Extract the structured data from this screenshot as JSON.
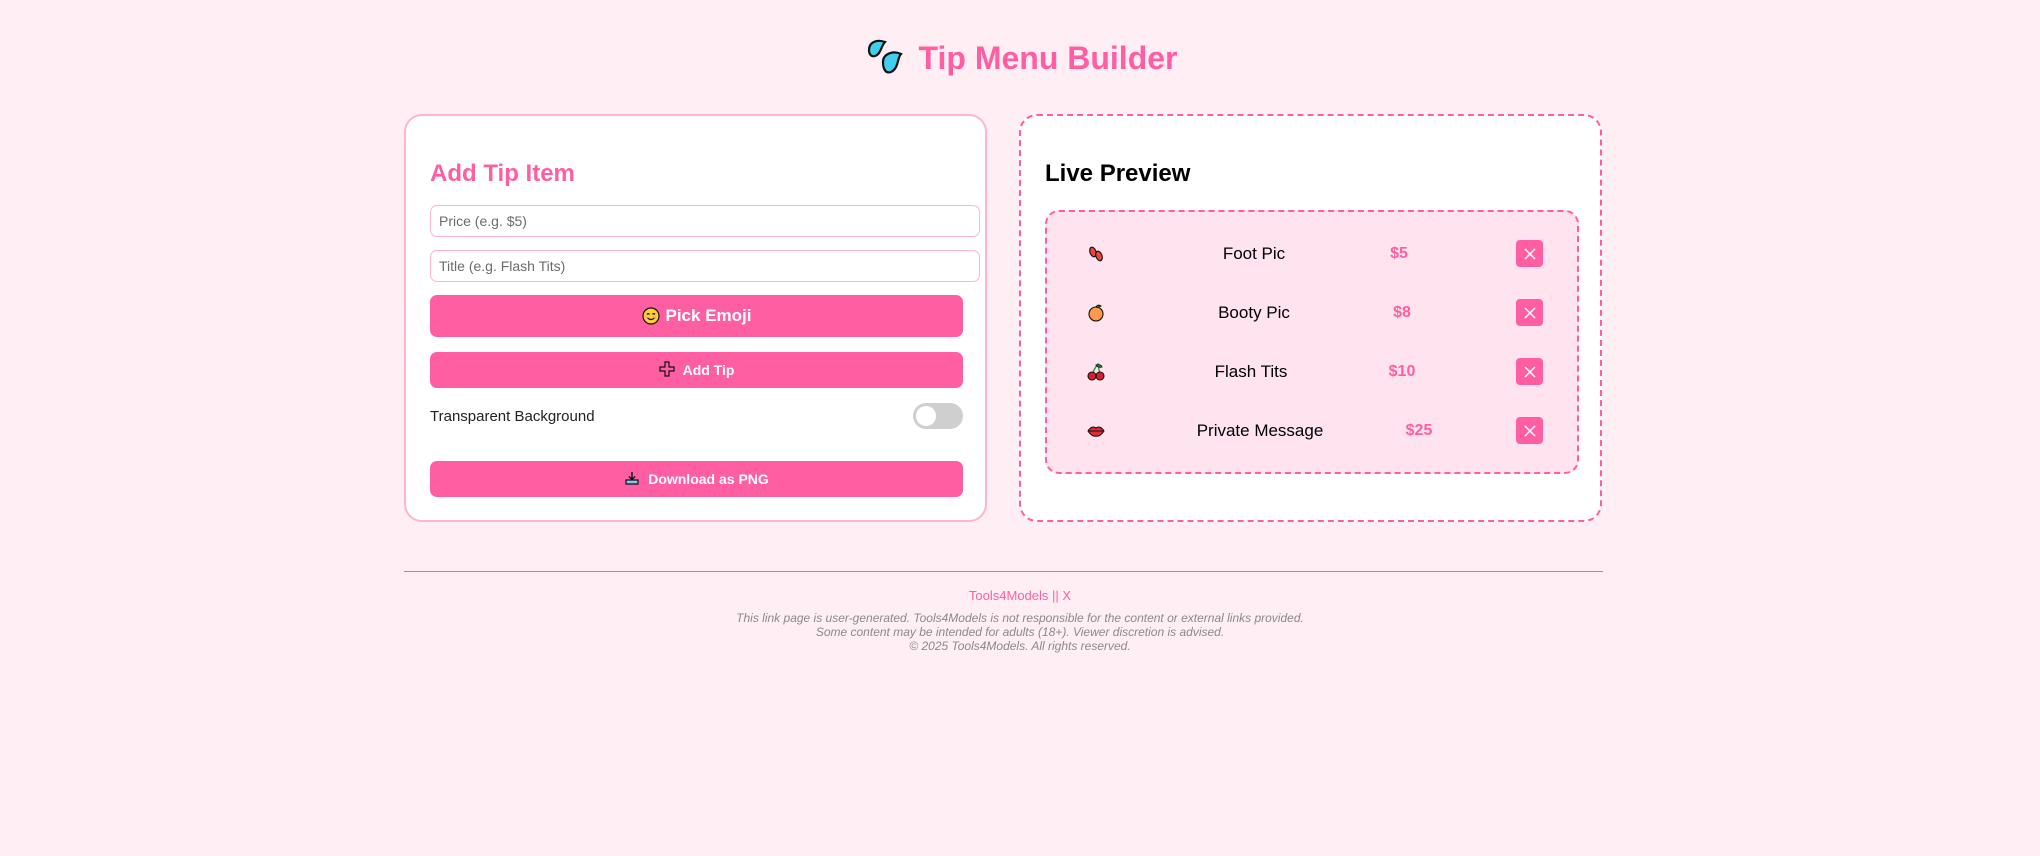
{
  "header": {
    "title": "Tip Menu Builder",
    "logo_icon": "sweat-droplets-icon"
  },
  "form": {
    "heading": "Add Tip Item",
    "price_placeholder": "Price (e.g. $5)",
    "price_value": "",
    "title_placeholder": "Title (e.g. Flash Tits)",
    "title_value": "",
    "pick_emoji_label": "Pick Emoji",
    "pick_emoji_icon": "smiling-face-icon",
    "add_tip_label": "Add Tip",
    "add_tip_icon": "plus-icon",
    "transparent_label": "Transparent Background",
    "transparent_on": false,
    "download_label": "Download as PNG",
    "download_icon": "download-tray-icon"
  },
  "preview": {
    "heading": "Live Preview",
    "items": [
      {
        "emoji": "footprints-icon",
        "title": "Foot Pic",
        "price": "$5"
      },
      {
        "emoji": "peach-icon",
        "title": "Booty Pic",
        "price": "$8"
      },
      {
        "emoji": "cherries-icon",
        "title": "Flash Tits",
        "price": "$10"
      },
      {
        "emoji": "lips-icon",
        "title": "Private Message",
        "price": "$25"
      }
    ]
  },
  "footer": {
    "brand_link": "Tools4Models",
    "separator": " || ",
    "x_link": "X",
    "disclaimer_lines": [
      "This link page is user-generated. Tools4Models is not responsible for the content or external links provided.",
      "Some content may be intended for adults (18+). Viewer discretion is advised.",
      "© 2025 Tools4Models. All rights reserved."
    ]
  },
  "colors": {
    "accent": "#ff5fa2",
    "background": "#ffeef4",
    "preview_fill": "#ffe3ee",
    "input_border": "#ffb4d2"
  }
}
